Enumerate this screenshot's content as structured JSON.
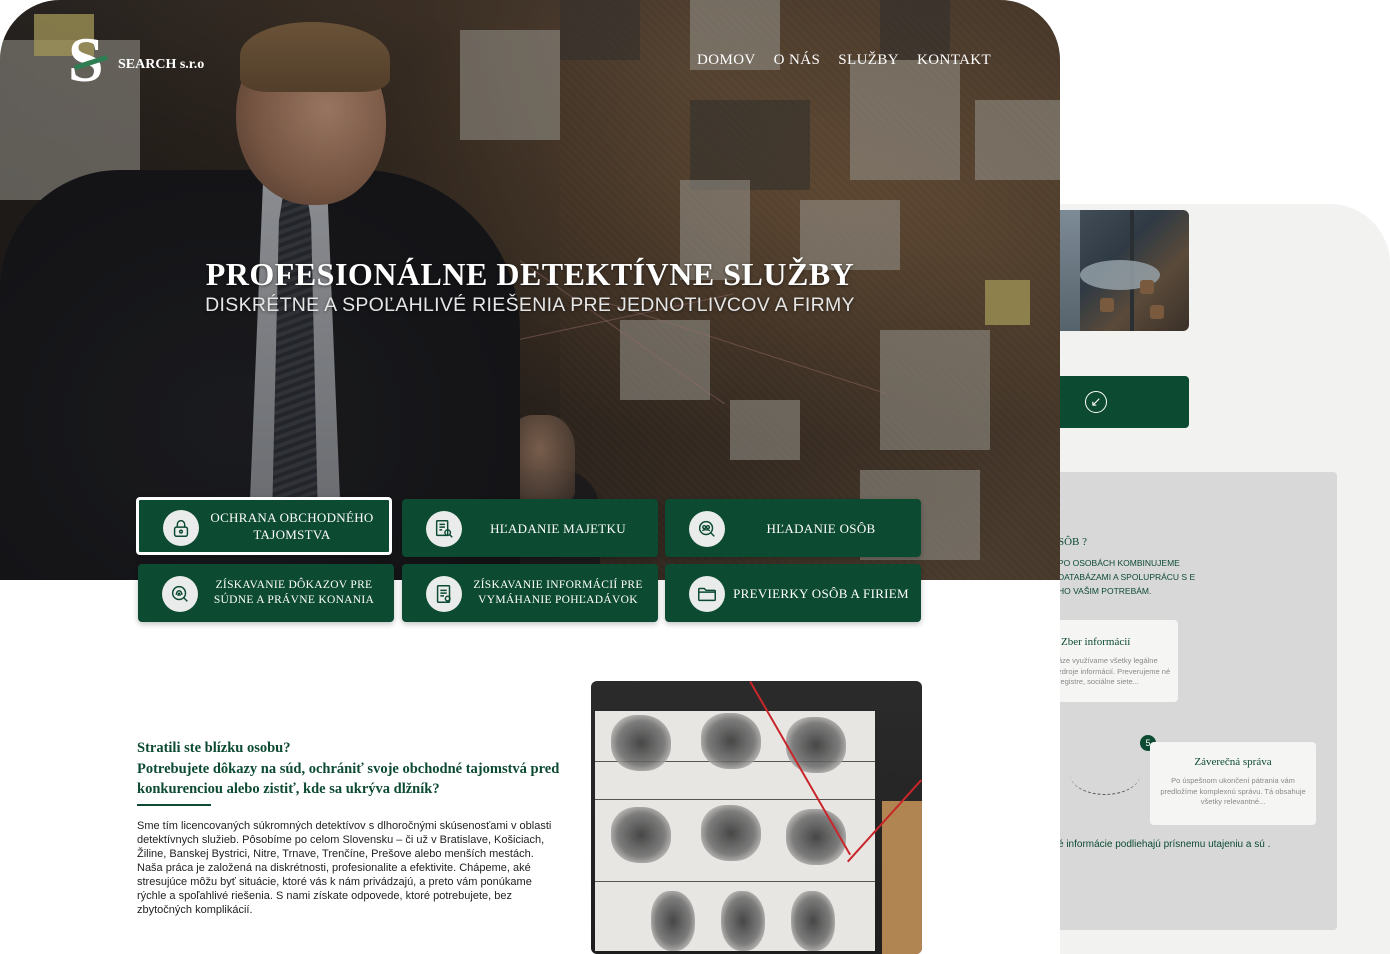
{
  "brand": {
    "name": "SEARCH s.r.o",
    "logo_letter": "S"
  },
  "nav": [
    "DOMOV",
    "O NÁS",
    "SLUŽBY",
    "KONTAKT"
  ],
  "hero": {
    "title": "PROFESIONÁLNE  DETEKTÍVNE SLUŽBY",
    "subtitle": "DISKRÉTNE A SPOĽAHLIVÉ RIEŠENIA PRE JEDNOTLIVCOV A FIRMY"
  },
  "services": [
    {
      "label": "OCHRANA OBCHODNÉHO TAJOMSTVA",
      "icon": "lock-icon",
      "active": true
    },
    {
      "label": "HĽADANIE MAJETKU",
      "icon": "document-search-icon",
      "active": false
    },
    {
      "label": "HĽADANIE OSÔB",
      "icon": "people-search-icon",
      "active": false
    },
    {
      "label": "ZÍSKAVANIE DÔKAZOV PRE SÚDNE A PRÁVNE KONANIA",
      "icon": "fingerprint-search-icon",
      "active": false
    },
    {
      "label": "ZÍSKAVANIE INFORMÁCIÍ PRE VYMÁHANIE POHĽADÁVOK",
      "icon": "document-list-icon",
      "active": false
    },
    {
      "label": "PREVIERKY OSÔB A FIRIEM",
      "icon": "folder-icon",
      "active": false
    }
  ],
  "intro": {
    "question": "Stratili ste blízku osobu?\nPotrebujete dôkazy na súd, ochrániť svoje obchodné tajomstvá pred konkurenciou alebo zistiť, kde sa ukrýva dlžník?",
    "paragraph": "Sme tím licencovaných súkromných detektívov s dlhoročnými skúsenosťami v oblasti detektívnych služieb. Pôsobíme po celom Slovensku – či už v Bratislave, Košiciach, Žiline, Banskej Bystrici, Nitre, Trnave, Trenčíne, Prešove alebo menších mestách. Naša práca je založená na diskrétnosti, profesionalite a efektivite. Chápeme, aké stresujúce môžu byť situácie, ktoré vás k nám privádzajú, a preto vám ponúkame rýchle a spoľahlivé riešenia. S nami získate odpovede, ktoré potrebujete, bez zbytočných komplikácií."
  },
  "back_page": {
    "button_icon": "arrow-down-left-icon",
    "question": "SÔB ?",
    "paragraph": "PO OSOBÁCH KOMBINUJEME DATABÁZAMI A SPOLUPRÁCU S E HO VAŠIM POTREBÁM.",
    "card1": {
      "title": "Zber informácií",
      "text": "áze využívame všetky legálne zdroje informácií. Preverujeme né registre, sociálne siete..."
    },
    "step_number": "5",
    "card2": {
      "title": "Záverečná správa",
      "text": "Po úspešnom ukončení pátrania vám predložíme komplexnú správu. Tá obsahuje všetky relevantné..."
    },
    "footer": "é informácie podliehajú prísnemu utajeniu a sú ."
  },
  "colors": {
    "brand_green": "#0c4a32",
    "accent_green": "#2f7d52",
    "panel_gray": "#d8d8d8"
  }
}
